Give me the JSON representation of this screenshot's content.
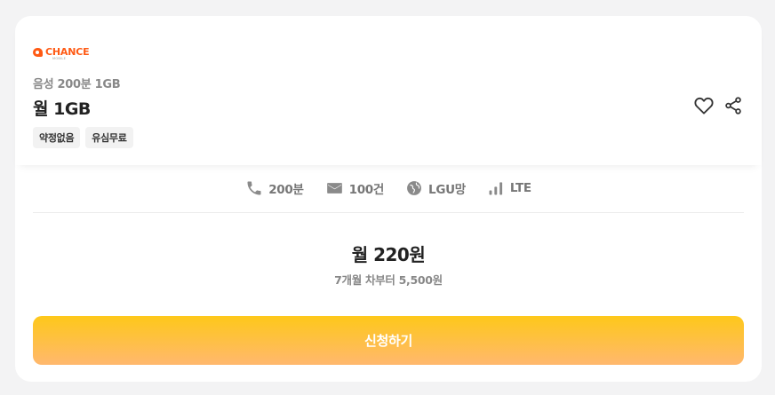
{
  "brand": {
    "logo_text": "CHANCE",
    "logo_sub": "MOBILE",
    "accent_color": "#ff5a14"
  },
  "plan": {
    "subtitle": "음성 200분 1GB",
    "title": "월 1GB",
    "tags": [
      "약정없음",
      "유심무료"
    ]
  },
  "actions": {
    "favorite_icon": "heart-icon",
    "share_icon": "share-icon"
  },
  "specs": [
    {
      "icon": "phone-icon",
      "label": "200분"
    },
    {
      "icon": "mail-icon",
      "label": "100건"
    },
    {
      "icon": "globe-icon",
      "label": "LGU망"
    },
    {
      "icon": "signal-icon",
      "label": "LTE"
    }
  ],
  "pricing": {
    "price": "월 220원",
    "note": "7개월 차부터 5,500원"
  },
  "cta": {
    "label": "신청하기",
    "gradient_top": "#fec81a",
    "gradient_bottom": "#ffb86e"
  }
}
